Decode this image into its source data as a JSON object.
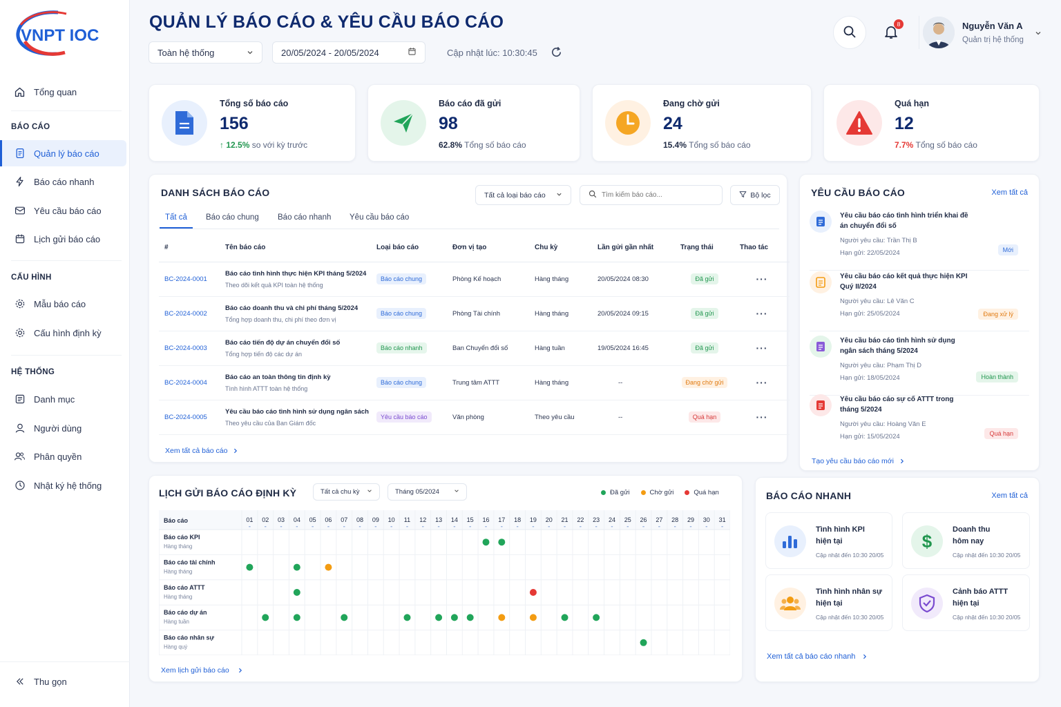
{
  "brand": {
    "logo_text": "VNPT IOC"
  },
  "sidebar": {
    "overview": "Tổng quan",
    "sections": {
      "reports": "BÁO CÁO",
      "config": "CẤU HÌNH",
      "system": "HỆ THỐNG"
    },
    "items": [
      {
        "label": "Quản lý báo cáo",
        "icon": "report-icon"
      },
      {
        "label": "Báo cáo nhanh",
        "icon": "lightning-icon"
      },
      {
        "label": "Yêu cầu báo cáo",
        "icon": "mail-icon"
      },
      {
        "label": "Lịch gửi báo cáo",
        "icon": "calendar-icon"
      },
      {
        "label": "Mẫu báo cáo",
        "icon": "gear-icon"
      },
      {
        "label": "Cấu hình định kỳ",
        "icon": "gear-icon"
      },
      {
        "label": "Danh mục",
        "icon": "list-icon"
      },
      {
        "label": "Người dùng",
        "icon": "user-icon"
      },
      {
        "label": "Phân quyền",
        "icon": "users-icon"
      },
      {
        "label": "Nhật ký hệ thống",
        "icon": "clock-icon"
      }
    ],
    "collapse": "Thu gọn"
  },
  "header": {
    "title": "QUẢN LÝ BÁO CÁO & YÊU CẦU BÁO CÁO",
    "scope": "Toàn hệ thống",
    "date_range": "20/05/2024 - 20/05/2024",
    "updated": "Cập nhật lúc: 10:30:45",
    "notif_count": "8",
    "user_name": "Nguyễn Văn A",
    "user_role": "Quản trị hệ thống"
  },
  "stats": [
    {
      "label": "Tổng số báo cáo",
      "value": "156",
      "delta": "↑ 12.5%",
      "note": "so với kỳ trước",
      "color": "#2f6bd8"
    },
    {
      "label": "Báo cáo đã gửi",
      "value": "98",
      "delta": "62.8%",
      "note": "Tổng số báo cáo",
      "color": "#21964f"
    },
    {
      "label": "Đang chờ gửi",
      "value": "24",
      "delta": "15.4%",
      "note": "Tổng số báo cáo",
      "color": "#f59e0b"
    },
    {
      "label": "Quá hạn",
      "value": "12",
      "delta": "7.7%",
      "note": "Tổng số báo cáo",
      "color": "#e53935"
    }
  ],
  "report_list": {
    "title": "DANH SÁCH BÁO CÁO",
    "type_filter": "Tất cả loại báo cáo",
    "search_placeholder": "Tìm kiếm báo cáo...",
    "filter_btn": "Bộ lọc",
    "tabs": [
      "Tất cả",
      "Báo cáo chung",
      "Báo cáo nhanh",
      "Yêu cầu báo cáo"
    ],
    "columns": [
      "#",
      "Tên báo cáo",
      "Loại báo cáo",
      "Đơn vị tạo",
      "Chu kỳ",
      "Lần gửi gần nhất",
      "Trạng thái",
      "Thao tác"
    ],
    "rows": [
      {
        "id": "BC-2024-0001",
        "name": "Báo cáo tình hình thực hiện KPI tháng 5/2024",
        "desc": "Theo dõi kết quả KPI toàn hệ thống",
        "type": "Báo cáo chung",
        "tcls": "b-chung",
        "unit": "Phòng Kế hoạch",
        "cycle": "Hàng tháng",
        "last": "20/05/2024 08:30",
        "status": "Đã gửi",
        "scls": "s-sent"
      },
      {
        "id": "BC-2024-0002",
        "name": "Báo cáo doanh thu và chi phí tháng 5/2024",
        "desc": "Tổng hợp doanh thu, chi phí theo đơn vị",
        "type": "Báo cáo chung",
        "tcls": "b-chung",
        "unit": "Phòng Tài chính",
        "cycle": "Hàng tháng",
        "last": "20/05/2024 09:15",
        "status": "Đã gửi",
        "scls": "s-sent"
      },
      {
        "id": "BC-2024-0003",
        "name": "Báo cáo tiến độ dự án chuyển đổi số",
        "desc": "Tổng hợp tiến độ các dự án",
        "type": "Báo cáo nhanh",
        "tcls": "b-nhanh",
        "unit": "Ban Chuyển đổi số",
        "cycle": "Hàng tuần",
        "last": "19/05/2024 16:45",
        "status": "Đã gửi",
        "scls": "s-sent"
      },
      {
        "id": "BC-2024-0004",
        "name": "Báo cáo an toàn thông tin định kỳ",
        "desc": "Tình hình ATTT toàn hệ thống",
        "type": "Báo cáo chung",
        "tcls": "b-chung",
        "unit": "Trung tâm ATTT",
        "cycle": "Hàng tháng",
        "last": "--",
        "status": "Đang chờ gửi",
        "scls": "s-wait"
      },
      {
        "id": "BC-2024-0005",
        "name": "Yêu cầu báo cáo tình hình sử dụng ngân sách",
        "desc": "Theo yêu cầu của Ban Giám đốc",
        "type": "Yêu cầu báo cáo",
        "tcls": "b-yc",
        "unit": "Văn phòng",
        "cycle": "Theo yêu cầu",
        "last": "--",
        "status": "Quá hạn",
        "scls": "s-late"
      }
    ],
    "view_all": "Xem tất cả báo cáo"
  },
  "requests": {
    "title": "YÊU CẦU BÁO CÁO",
    "view_all": "Xem tất cả",
    "items": [
      {
        "title": "Yêu cầu báo cáo tình hình triển khai đề án chuyển đổi số",
        "requester": "Người yêu cầu:  Trần Thị B",
        "due": "Hạn gửi:  22/05/2024",
        "status": "Mới",
        "color": "#2f6bd8",
        "bg": "#e8f0fd"
      },
      {
        "title": "Yêu cầu báo cáo kết quả thực hiện KPI Quý II/2024",
        "requester": "Người yêu cầu:  Lê Văn C",
        "due": "Hạn gửi:  25/05/2024",
        "status": "Đang xử lý",
        "color": "#e07a10",
        "bg": "#fff1e2"
      },
      {
        "title": "Yêu cầu báo cáo tình hình sử dụng ngân sách tháng 5/2024",
        "requester": "Người yêu cầu:  Phạm Thị D",
        "due": "Hạn gửi:  18/05/2024",
        "status": "Hoàn thành",
        "color": "#21964f",
        "bg": "#e4f5ea"
      },
      {
        "title": "Yêu cầu báo cáo sự cố ATTT trong tháng 5/2024",
        "requester": "Người yêu cầu:  Hoàng Văn E",
        "due": "Hạn gửi:  15/05/2024",
        "status": "Quá hạn",
        "color": "#d63a3a",
        "bg": "#fde8e8"
      }
    ],
    "create": "Tạo yêu cầu báo cáo mới"
  },
  "schedule": {
    "title": "LỊCH GỬI BÁO CÁO ĐỊNH KỲ",
    "cycle_filter": "Tất cả chu kỳ",
    "month_filter": "Tháng 05/2024",
    "legend": [
      {
        "label": "Đã gửi",
        "color": "#21a55a"
      },
      {
        "label": "Chờ gửi",
        "color": "#f39c12"
      },
      {
        "label": "Quá hạn",
        "color": "#e53935"
      }
    ],
    "col_header": "Báo cáo",
    "days": [
      "01",
      "02",
      "03",
      "04",
      "05",
      "06",
      "07",
      "08",
      "09",
      "10",
      "11",
      "12",
      "13",
      "14",
      "15",
      "16",
      "17",
      "18",
      "19",
      "20",
      "21",
      "22",
      "23",
      "24",
      "25",
      "26",
      "27",
      "28",
      "29",
      "30",
      "31"
    ],
    "rows": [
      {
        "name": "Báo cáo KPI",
        "cycle": "Hàng tháng",
        "events": [
          [
            16,
            "s"
          ],
          [
            17,
            "s"
          ]
        ]
      },
      {
        "name": "Báo cáo tài chính",
        "cycle": "Hàng tháng",
        "events": [
          [
            1,
            "s"
          ],
          [
            4,
            "s"
          ],
          [
            6,
            "w"
          ]
        ]
      },
      {
        "name": "Báo cáo ATTT",
        "cycle": "Hàng tháng",
        "events": [
          [
            4,
            "s"
          ],
          [
            19,
            "l"
          ]
        ]
      },
      {
        "name": "Báo cáo dự án",
        "cycle": "Hàng tuần",
        "events": [
          [
            2,
            "s"
          ],
          [
            4,
            "s"
          ],
          [
            7,
            "s"
          ],
          [
            11,
            "s"
          ],
          [
            13,
            "s"
          ],
          [
            14,
            "s"
          ],
          [
            15,
            "s"
          ],
          [
            17,
            "w"
          ],
          [
            19,
            "w"
          ],
          [
            21,
            "s"
          ],
          [
            23,
            "s"
          ]
        ]
      },
      {
        "name": "Báo cáo nhân sự",
        "cycle": "Hàng quý",
        "events": [
          [
            26,
            "s"
          ]
        ]
      }
    ],
    "view_all": "Xem lịch gửi báo cáo"
  },
  "quick": {
    "title": "BÁO CÁO NHANH",
    "view_all": "Xem tất cả",
    "items": [
      {
        "line1": "Tình hình KPI",
        "line2": "hiện tại",
        "sub": "Cập nhật đến 10:30 20/05",
        "color": "#2f6bd8",
        "bg": "#e8f0fd"
      },
      {
        "line1": "Doanh thu",
        "line2": "hôm nay",
        "sub": "Cập nhật đến 10:30 20/05",
        "color": "#21964f",
        "bg": "#e4f5ea"
      },
      {
        "line1": "Tình hình nhân sự",
        "line2": "hiện tại",
        "sub": "Cập nhật đến 10:30 20/05",
        "color": "#f39c12",
        "bg": "#fff1e2"
      },
      {
        "line1": "Cảnh báo ATTT",
        "line2": "hiện tại",
        "sub": "Cập nhật đến 10:30 20/05",
        "color": "#7a4bd0",
        "bg": "#f1eafb"
      }
    ],
    "view_all_quick": "Xem tất cả báo cáo nhanh"
  }
}
